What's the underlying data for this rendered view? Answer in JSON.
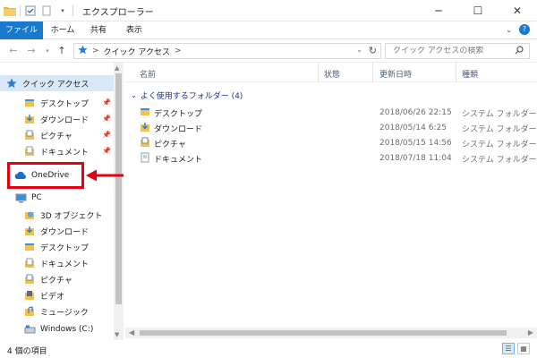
{
  "window": {
    "title": "エクスプローラー"
  },
  "ribbon": {
    "tabs": [
      "ファイル",
      "ホーム",
      "共有",
      "表示"
    ]
  },
  "address": {
    "path_root_chevron": ">",
    "location": "クイック アクセス",
    "trailing_chevron": ">"
  },
  "search": {
    "placeholder": "クイック アクセスの検索"
  },
  "navpane": {
    "quick_access": "クイック アクセス",
    "quick_items": [
      "デスクトップ",
      "ダウンロード",
      "ピクチャ",
      "ドキュメント"
    ],
    "onedrive": "OneDrive",
    "pc": "PC",
    "pc_items": [
      "3D オブジェクト",
      "ダウンロード",
      "デスクトップ",
      "ドキュメント",
      "ピクチャ",
      "ビデオ",
      "ミュージック",
      "Windows (C:)"
    ]
  },
  "content": {
    "columns": [
      "名前",
      "状態",
      "更新日時",
      "種類"
    ],
    "group_label": "よく使用するフォルダー (4)",
    "rows": [
      {
        "name": "デスクトップ",
        "date": "2018/06/26 22:15",
        "kind": "システム フォルダー"
      },
      {
        "name": "ダウンロード",
        "date": "2018/05/14 6:25",
        "kind": "システム フォルダー"
      },
      {
        "name": "ピクチャ",
        "date": "2018/05/15 14:56",
        "kind": "システム フォルダー"
      },
      {
        "name": "ドキュメント",
        "date": "2018/07/18 11:04",
        "kind": "システム フォルダー"
      }
    ]
  },
  "statusbar": {
    "item_count": "4 個の項目"
  },
  "colors": {
    "accent": "#1979ca",
    "highlight": "#e60012",
    "selected_bg": "#d9e8f7"
  },
  "icons": {
    "quick_access": "star-icon",
    "onedrive": "cloud-icon",
    "pc": "computer-icon",
    "folder": "folder-icon"
  }
}
